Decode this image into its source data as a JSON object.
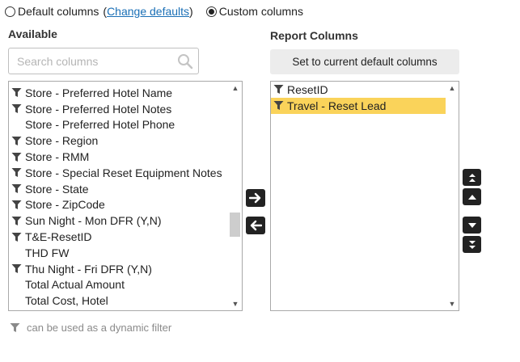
{
  "mode": {
    "default_label": "Default columns",
    "change_defaults_open": "(",
    "change_defaults_link": "Change defaults",
    "change_defaults_close": ")",
    "custom_label": "Custom columns",
    "selected": "custom"
  },
  "available": {
    "heading": "Available",
    "search_placeholder": "Search columns",
    "items": [
      {
        "label": "Store - Preferred Hotel Name",
        "filter": true
      },
      {
        "label": "Store - Preferred Hotel Notes",
        "filter": true
      },
      {
        "label": "Store - Preferred Hotel Phone",
        "filter": false
      },
      {
        "label": "Store - Region",
        "filter": true
      },
      {
        "label": "Store - RMM",
        "filter": true
      },
      {
        "label": "Store - Special Reset Equipment Notes",
        "filter": true
      },
      {
        "label": "Store - State",
        "filter": true
      },
      {
        "label": "Store - ZipCode",
        "filter": true
      },
      {
        "label": "Sun Night - Mon DFR (Y,N)",
        "filter": true
      },
      {
        "label": "T&E-ResetID",
        "filter": true
      },
      {
        "label": "THD FW",
        "filter": false
      },
      {
        "label": "Thu Night - Fri DFR (Y,N)",
        "filter": true
      },
      {
        "label": "Total Actual Amount",
        "filter": false
      },
      {
        "label": "Total Cost, Hotel",
        "filter": false
      }
    ]
  },
  "report": {
    "heading": "Report Columns",
    "set_default_button": "Set to current default columns",
    "items": [
      {
        "label": "ResetID",
        "filter": true,
        "selected": false
      },
      {
        "label": "Travel - Reset Lead",
        "filter": true,
        "selected": true
      }
    ]
  },
  "legend": {
    "text": "can be used as a dynamic filter"
  },
  "colors": {
    "selected_row": "#fad35a",
    "link": "#1a6fb6",
    "button_dark": "#222222"
  }
}
